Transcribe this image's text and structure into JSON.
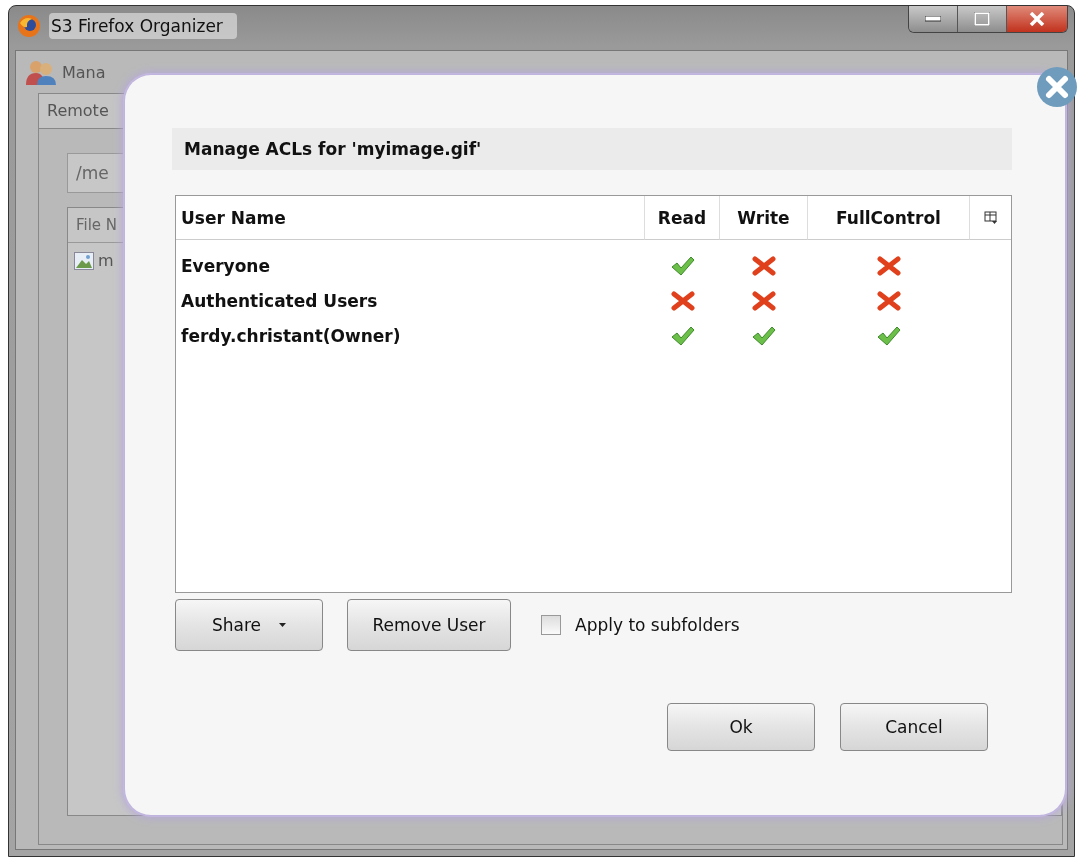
{
  "window": {
    "title": "S3 Firefox Organizer"
  },
  "background": {
    "toolbar_label": "Mana",
    "tab": "Remote",
    "path": "/me",
    "column": "File N",
    "file": "m"
  },
  "dialog": {
    "heading": "Manage ACLs for 'myimage.gif'",
    "columns": [
      "User Name",
      "Read",
      "Write",
      "FullControl"
    ],
    "rows": [
      {
        "user": "Everyone",
        "permissions": [
          true,
          false,
          false
        ]
      },
      {
        "user": "Authenticated Users",
        "permissions": [
          false,
          false,
          false
        ]
      },
      {
        "user": "ferdy.christant(Owner)",
        "permissions": [
          true,
          true,
          true
        ]
      }
    ],
    "share_button": "Share",
    "remove_button": "Remove User",
    "apply_to_subfolders": {
      "label": "Apply to subfolders",
      "checked": false
    },
    "ok_button": "Ok",
    "cancel_button": "Cancel"
  }
}
